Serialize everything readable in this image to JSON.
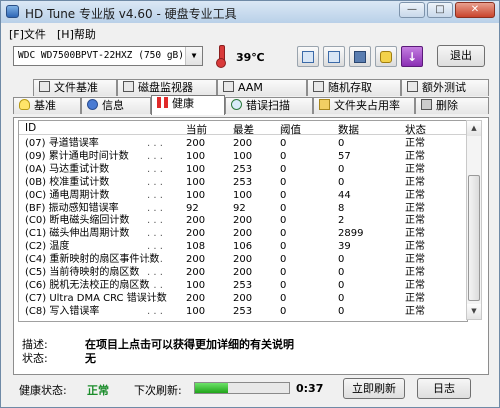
{
  "window": {
    "title": "HD Tune 专业版 v4.60 - 硬盘专业工具",
    "controls": [
      "—",
      "□",
      "✕"
    ]
  },
  "menu": [
    "[F]文件",
    "[H]帮助"
  ],
  "toolbar": {
    "drive_model": "WDC WD7500BPVT-22HXZ",
    "drive_capacity": "(750 gB)",
    "temperature": "39℃",
    "exit_label": "退出"
  },
  "tabs_row1": [
    "文件基准",
    "磁盘监视器",
    "AAM",
    "随机存取",
    "额外测试"
  ],
  "tabs_row2": [
    "基准",
    "信息",
    "健康",
    "错误扫描",
    "文件夹占用率",
    "删除"
  ],
  "active_tab": "健康",
  "table": {
    "headers": [
      "ID",
      "当前",
      "最差",
      "阈值",
      "数据",
      "状态"
    ],
    "rows": [
      [
        "(07) 寻道错误率",
        "200",
        "200",
        "0",
        "0",
        "正常"
      ],
      [
        "(09) 累计通电时间计数",
        "100",
        "100",
        "0",
        "57",
        "正常"
      ],
      [
        "(0A) 马达重试计数",
        "100",
        "253",
        "0",
        "0",
        "正常"
      ],
      [
        "(0B) 校准重试计数",
        "100",
        "253",
        "0",
        "0",
        "正常"
      ],
      [
        "(0C) 通电周期计数",
        "100",
        "100",
        "0",
        "44",
        "正常"
      ],
      [
        "(BF) 振动感知错误率",
        "92",
        "92",
        "0",
        "8",
        "正常"
      ],
      [
        "(C0) 断电磁头缩回计数",
        "200",
        "200",
        "0",
        "2",
        "正常"
      ],
      [
        "(C1) 磁头伸出周期计数",
        "200",
        "200",
        "0",
        "2899",
        "正常"
      ],
      [
        "(C2) 温度",
        "108",
        "106",
        "0",
        "39",
        "正常"
      ],
      [
        "(C4) 重新映射的扇区事件计数",
        "200",
        "200",
        "0",
        "0",
        "正常"
      ],
      [
        "(C5) 当前待映射的扇区数",
        "200",
        "200",
        "0",
        "0",
        "正常"
      ],
      [
        "(C6) 脱机无法校正的扇区数",
        "100",
        "253",
        "0",
        "0",
        "正常"
      ],
      [
        "(C7) Ultra DMA CRC 错误计数",
        "200",
        "200",
        "0",
        "0",
        "正常"
      ],
      [
        "(C8) 写入错误率",
        "100",
        "253",
        "0",
        "0",
        "正常"
      ]
    ]
  },
  "description": {
    "desc_label": "描述:",
    "desc_value": "在项目上点击可以获得更加详细的有关说明",
    "status_label": "状态:",
    "status_value": "无"
  },
  "statusbar": {
    "health_label": "健康状态:",
    "health_value": "正常",
    "next_refresh_label": "下次刷新:",
    "refresh_progress": 0.35,
    "countdown": "0:37",
    "refresh_now_label": "立即刷新",
    "log_label": "日志"
  }
}
